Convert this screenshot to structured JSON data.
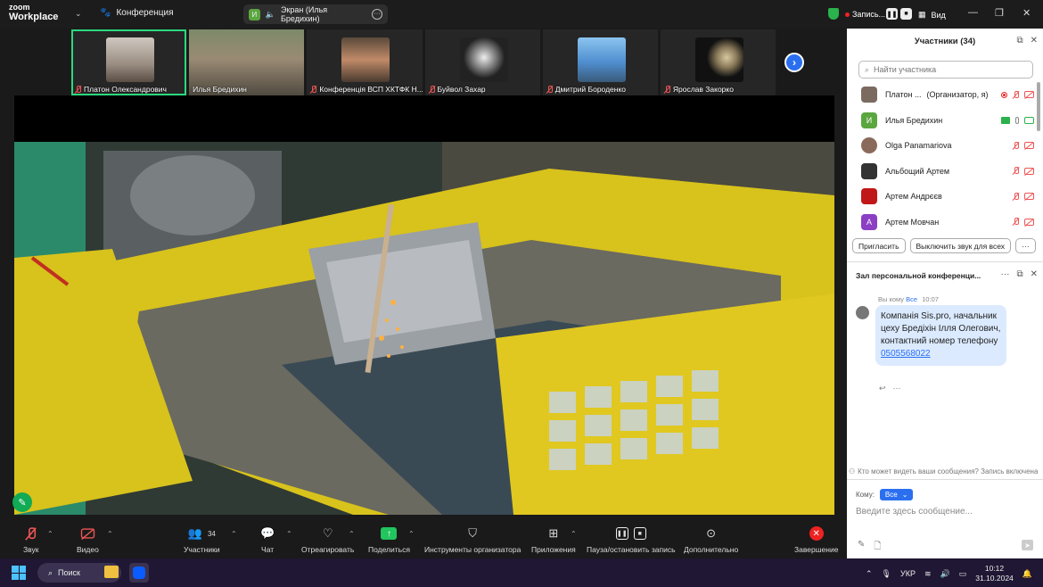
{
  "app": {
    "brand_top": "zoom",
    "brand_bottom": "Workplace",
    "meeting_label": "Конференция",
    "screen_share_label": "Экран (Илья Бредихин)",
    "screen_share_avatar": "И",
    "recording_label": "Запись...",
    "view_label": "Вид"
  },
  "thumbnails": [
    {
      "name": "Платон Олександрович",
      "muted": true,
      "active": true,
      "color": "#a8a29a"
    },
    {
      "name": "Илья Бредихин",
      "muted": false,
      "active": false,
      "color": "#6c7a5a"
    },
    {
      "name": "Конференція ВСП ХКТФК Н...",
      "muted": true,
      "active": false,
      "color": "#8a5a3a"
    },
    {
      "name": "Буйвол Захар",
      "muted": true,
      "active": false,
      "color": "#222222"
    },
    {
      "name": "Дмитрий Бороденко",
      "muted": true,
      "active": false,
      "color": "#4f8fd0"
    },
    {
      "name": "Ярослав Закорко",
      "muted": true,
      "active": false,
      "color": "#1a1a1a"
    }
  ],
  "toolbar": {
    "audio": "Звук",
    "video": "Видео",
    "participants": "Участники",
    "participants_count": "34",
    "chat": "Чат",
    "react": "Отреагировать",
    "share": "Поделиться",
    "host_tools": "Инструменты организатора",
    "apps": "Приложения",
    "pause_stop": "Пауза/остановить запись",
    "more": "Дополнительно",
    "end": "Завершение"
  },
  "participants_panel": {
    "title": "Участники (34)",
    "search_placeholder": "Найти участника",
    "list": [
      {
        "name": "Платон ...",
        "role": "(Организатор, я)",
        "avatar": "",
        "avatar_color": "#7a6a60",
        "status": "rec-muted"
      },
      {
        "name": "Илья Бредихин",
        "role": "",
        "avatar": "И",
        "avatar_color": "#5aa63f",
        "status": "sharing"
      },
      {
        "name": "Olga Panamariova",
        "role": "",
        "avatar": "",
        "avatar_color": "#8a6a5a",
        "status": "muted"
      },
      {
        "name": "Альбощий Артем",
        "role": "",
        "avatar": "",
        "avatar_color": "#333333",
        "status": "muted"
      },
      {
        "name": "Артем Андрєєв",
        "role": "",
        "avatar": "",
        "avatar_color": "#c01818",
        "status": "muted"
      },
      {
        "name": "Артем Мовчан",
        "role": "",
        "avatar": "А",
        "avatar_color": "#8b3fc4",
        "status": "muted"
      }
    ],
    "invite": "Пригласить",
    "mute_all": "Выключить звук для всех"
  },
  "chat_panel": {
    "title": "Зал персональной конференци...",
    "message": {
      "from": "Вы кому",
      "to": "Все",
      "time": "10:07",
      "text": "Компанія Sis.pro, начальник цеху Бредіхін Ілля Олегович, контактний номер телефону",
      "phone": "0505568022"
    },
    "note": "Кто может видеть ваши сообщения? Запись включена",
    "to_label": "Кому:",
    "to_value": "Все",
    "input_placeholder": "Введите здесь сообщение..."
  },
  "taskbar": {
    "search": "Поиск",
    "lang": "УКР",
    "time": "10:12",
    "date": "31.10.2024"
  }
}
